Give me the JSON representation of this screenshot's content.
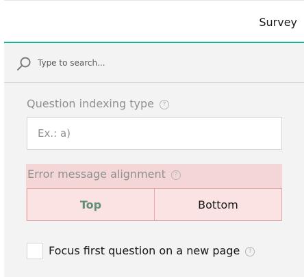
{
  "header": {
    "tab_label": "Survey"
  },
  "search": {
    "placeholder": "Type to search..."
  },
  "fields": {
    "question_indexing_type": {
      "label": "Question indexing type",
      "placeholder": "Ex.: a)"
    },
    "error_message_alignment": {
      "label": "Error message alignment",
      "options": [
        "Top",
        "Bottom"
      ],
      "selected": "Top"
    },
    "focus_first_question": {
      "label": "Focus first question on a new page",
      "checked": false
    }
  },
  "help_icon_glyph": "?",
  "colors": {
    "accent": "#19b394",
    "error_bg": "#f4d6d7",
    "selected_option_text": "#5f8f73"
  }
}
